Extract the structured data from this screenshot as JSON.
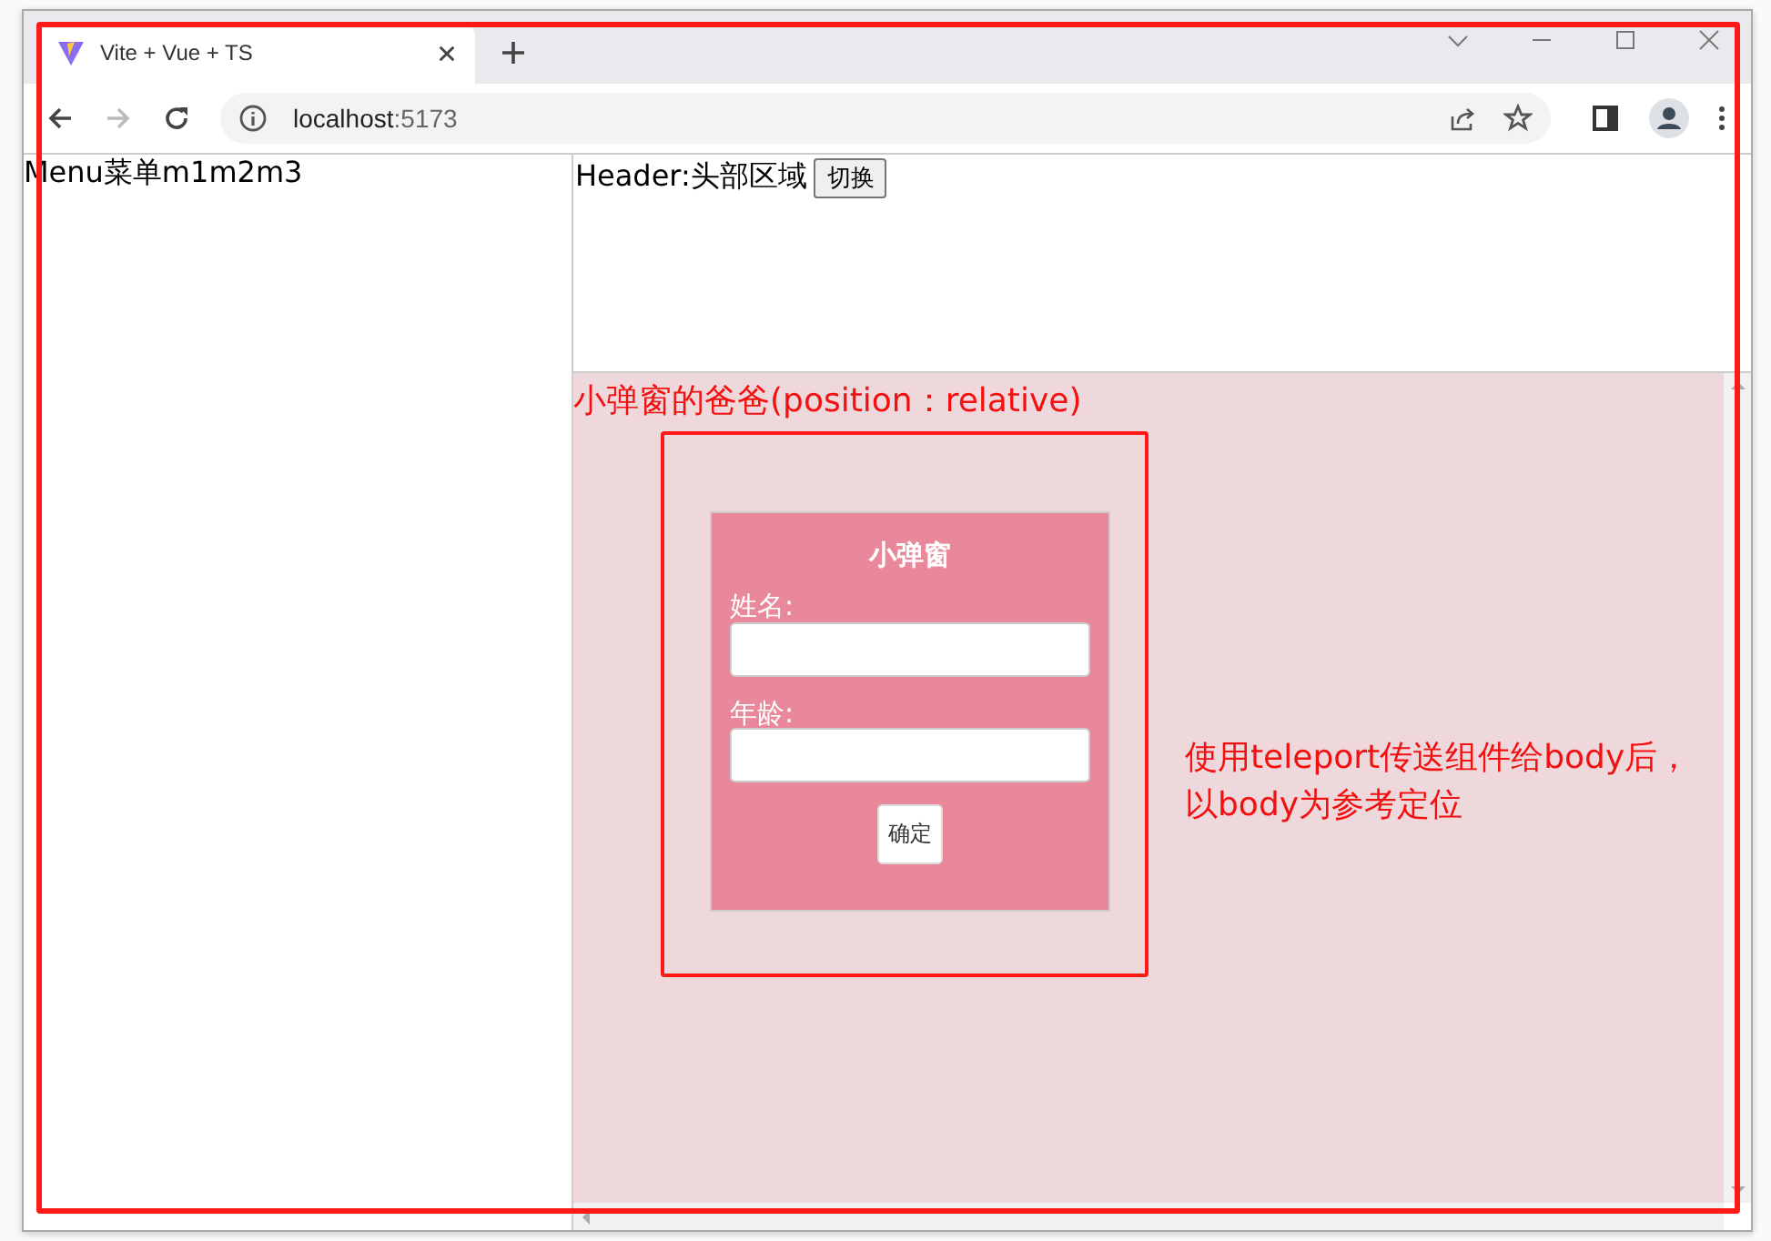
{
  "browser": {
    "tab_title": "Vite + Vue + TS",
    "url_host": "localhost",
    "url_port": ":5173",
    "forward_disabled": true
  },
  "sidebar": {
    "text": "Menu菜单m1m2m3"
  },
  "header": {
    "text": "Header:头部区域",
    "button": "切换"
  },
  "main": {
    "parent_label": "小弹窗的爸爸(position：relative)",
    "note": "使用teleport传送组件给body后，以body为参考定位"
  },
  "popup": {
    "title": "小弹窗",
    "fields": [
      {
        "label": "姓名:"
      },
      {
        "label": "年龄:"
      }
    ],
    "button": "确定"
  }
}
